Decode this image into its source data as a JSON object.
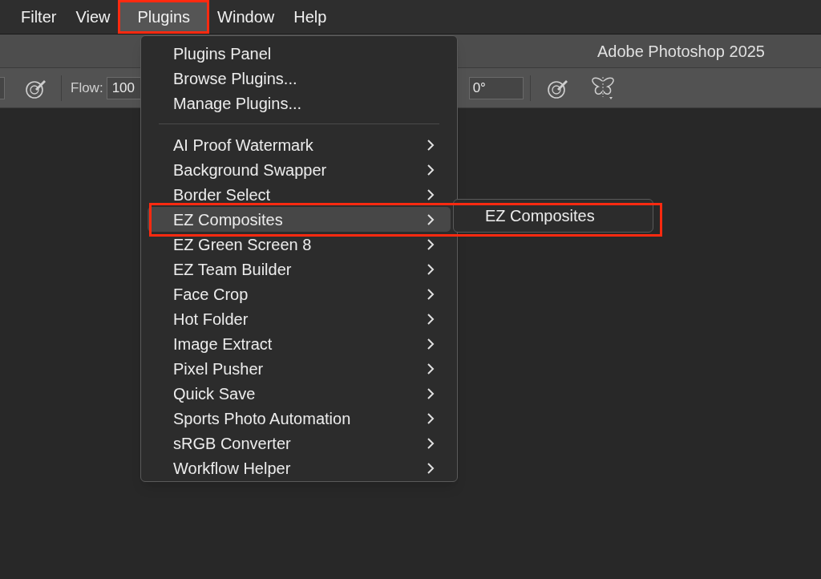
{
  "menu_bar": [
    {
      "label": "Filter",
      "selected": false,
      "annotated": false
    },
    {
      "label": "View",
      "selected": false,
      "annotated": false
    },
    {
      "label": "Plugins",
      "selected": true,
      "annotated": true
    },
    {
      "label": "Window",
      "selected": false,
      "annotated": false
    },
    {
      "label": "Help",
      "selected": false,
      "annotated": false
    }
  ],
  "window": {
    "title": "Adobe Photoshop 2025"
  },
  "options_bar": {
    "flow_label": "Flow:",
    "flow_value": "100",
    "angle_value": "0°"
  },
  "plugins_menu": {
    "top_items": [
      {
        "label": "Plugins Panel"
      },
      {
        "label": "Browse Plugins..."
      },
      {
        "label": "Manage Plugins..."
      }
    ],
    "items": [
      {
        "label": "AI Proof Watermark",
        "selected": false,
        "annotated": false
      },
      {
        "label": "Background Swapper",
        "selected": false,
        "annotated": false
      },
      {
        "label": "Border Select",
        "selected": false,
        "annotated": false
      },
      {
        "label": "EZ Composites",
        "selected": true,
        "annotated": true
      },
      {
        "label": "EZ Green Screen 8",
        "selected": false,
        "annotated": false
      },
      {
        "label": "EZ Team Builder",
        "selected": false,
        "annotated": false
      },
      {
        "label": "Face Crop",
        "selected": false,
        "annotated": false
      },
      {
        "label": "Hot Folder",
        "selected": false,
        "annotated": false
      },
      {
        "label": "Image Extract",
        "selected": false,
        "annotated": false
      },
      {
        "label": "Pixel Pusher",
        "selected": false,
        "annotated": false
      },
      {
        "label": "Quick Save",
        "selected": false,
        "annotated": false
      },
      {
        "label": "Sports Photo Automation",
        "selected": false,
        "annotated": false
      },
      {
        "label": "sRGB Converter",
        "selected": false,
        "annotated": false
      },
      {
        "label": "Workflow Helper",
        "selected": false,
        "annotated": false
      }
    ]
  },
  "submenu": {
    "items": [
      {
        "label": "EZ Composites"
      }
    ]
  }
}
